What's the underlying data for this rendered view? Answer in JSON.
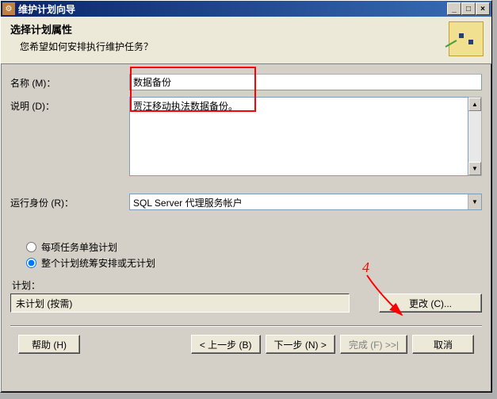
{
  "window": {
    "title": "维护计划向导"
  },
  "header": {
    "title": "选择计划属性",
    "subtitle": "您希望如何安排执行维护任务？"
  },
  "form": {
    "name_label": "名称 (M)：",
    "name_value": "数据备份",
    "desc_label": "说明 (D)：",
    "desc_value": "贾汪移动执法数据备份。",
    "runas_label": "运行身份 (R)：",
    "runas_value": "SQL Server 代理服务帐户"
  },
  "radios": {
    "opt1": "每项任务单独计划",
    "opt2": "整个计划统筹安排或无计划"
  },
  "plan": {
    "label": "计划：",
    "value": "未计划 (按需)",
    "change_btn": "更改 (C)..."
  },
  "footer": {
    "help": "帮助 (H)",
    "back": "< 上一步 (B)",
    "next": "下一步 (N) >",
    "finish": "完成 (F) >>|",
    "cancel": "取消"
  },
  "annotation": {
    "label": "4"
  }
}
